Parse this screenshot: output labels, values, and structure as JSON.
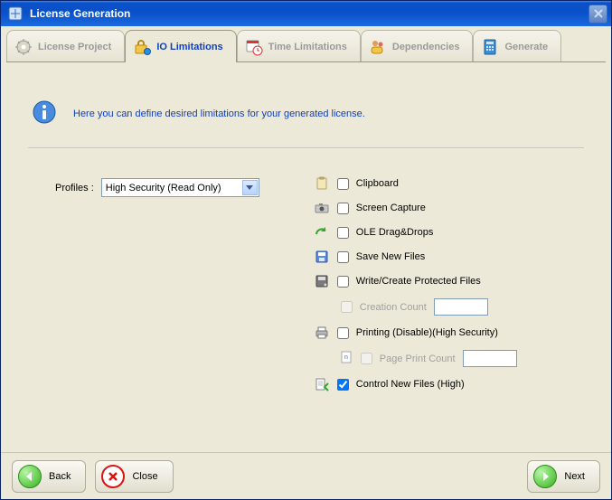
{
  "window": {
    "title": "License Generation"
  },
  "tabs": {
    "license_project": "License Project",
    "io_limitations": "IO Limitations",
    "time_limitations": "Time Limitations",
    "dependencies": "Dependencies",
    "generate": "Generate"
  },
  "info": "Here you can define desired limitations for your generated license.",
  "profiles": {
    "label": "Profiles :",
    "value": "High Security (Read Only)"
  },
  "limits": {
    "clipboard": "Clipboard",
    "screen_capture": "Screen Capture",
    "ole_dragdrops": "OLE Drag&Drops",
    "save_new_files": "Save New Files",
    "write_create_protected": "Write/Create Protected Files",
    "creation_count": "Creation Count",
    "printing": "Printing (Disable)(High Security)",
    "page_print_count": "Page Print Count",
    "control_new_files": "Control New Files (High)"
  },
  "checked": {
    "clipboard": false,
    "screen_capture": false,
    "ole_dragdrops": false,
    "save_new_files": false,
    "write_create_protected": false,
    "creation_count": false,
    "printing": false,
    "page_print_count": false,
    "control_new_files": true
  },
  "footer": {
    "back": "Back",
    "close": "Close",
    "next": "Next"
  }
}
